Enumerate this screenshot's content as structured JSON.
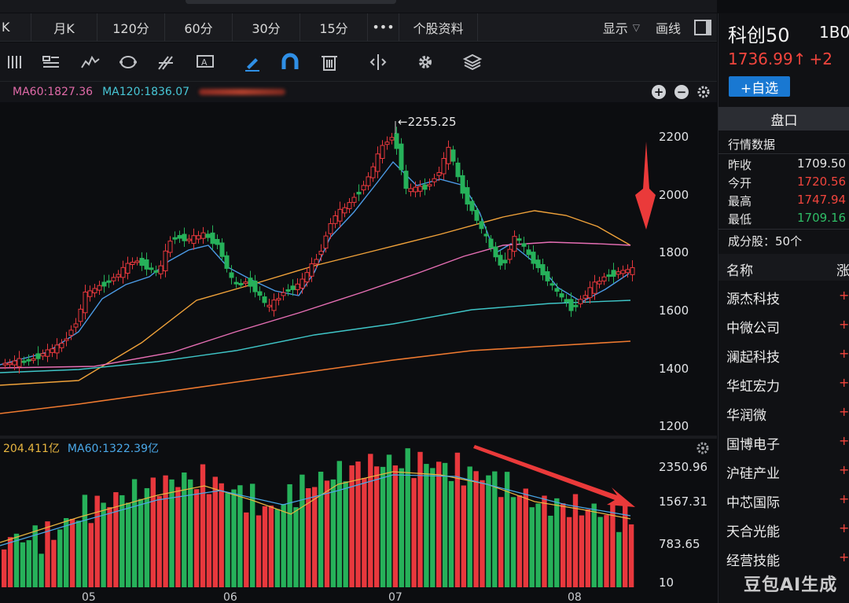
{
  "tabs": [
    "K",
    "月K",
    "120分",
    "60分",
    "30分",
    "15分",
    "•••",
    "个股资料"
  ],
  "tabs_right": {
    "display": "显示",
    "draw": "画线"
  },
  "ma_legend": {
    "ma60": "MA60:1827.36",
    "ma120": "MA120:1836.07"
  },
  "peak_label": "←2255.25",
  "price_axis": [
    "2200",
    "2000",
    "1800",
    "1600",
    "1400",
    "1200"
  ],
  "volume_legend": {
    "vol": "204.411亿",
    "ma60": "MA60:1322.39亿"
  },
  "volume_axis": [
    "2350.96",
    "1567.31",
    "783.65",
    "10"
  ],
  "x_axis": [
    "05",
    "06",
    "07",
    "08"
  ],
  "colors": {
    "up": "#e8383d",
    "down": "#26b15a",
    "accent": "#1978d2",
    "ma_orange": "#f0a23a",
    "ma_pink": "#e76fb5",
    "ma_cyan": "#3fc6c8",
    "ma_long": "#f07a30",
    "arrow": "#ea3a3a"
  },
  "panel": {
    "name": "科创50",
    "code": "1B0",
    "price": "1736.99↑",
    "change": "+2",
    "add_label": "+自选",
    "pankou": "盘口",
    "market_title": "行情数据",
    "quotes": [
      {
        "label": "昨收",
        "value": "1709.50",
        "color": "#e4e4e4"
      },
      {
        "label": "今开",
        "value": "1720.56",
        "color": "#f2453d"
      },
      {
        "label": "最高",
        "value": "1747.94",
        "color": "#f2453d"
      },
      {
        "label": "最低",
        "value": "1709.16",
        "color": "#2fbd66"
      }
    ],
    "constituents_title": "成分股：50个",
    "col_name": "名称",
    "col_change": "涨",
    "constituents": [
      {
        "name": "源杰科技",
        "change": "+"
      },
      {
        "name": "中微公司",
        "change": "+"
      },
      {
        "name": "澜起科技",
        "change": "+"
      },
      {
        "name": "华虹宏力",
        "change": "+"
      },
      {
        "name": "华润微",
        "change": "+"
      },
      {
        "name": "国博电子",
        "change": "+"
      },
      {
        "name": "沪硅产业",
        "change": "+"
      },
      {
        "name": "中芯国际",
        "change": "+"
      },
      {
        "name": "天合光能",
        "change": "+"
      },
      {
        "name": "经营技能",
        "change": "+"
      }
    ]
  },
  "watermark": "豆包AI生成"
}
